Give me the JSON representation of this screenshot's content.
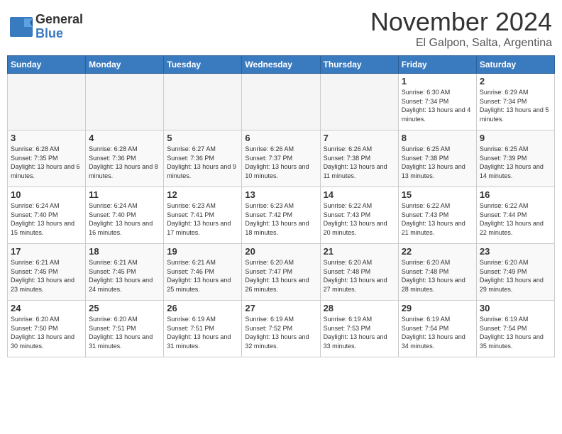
{
  "header": {
    "logo_general": "General",
    "logo_blue": "Blue",
    "month": "November 2024",
    "location": "El Galpon, Salta, Argentina"
  },
  "weekdays": [
    "Sunday",
    "Monday",
    "Tuesday",
    "Wednesday",
    "Thursday",
    "Friday",
    "Saturday"
  ],
  "weeks": [
    [
      {
        "day": "",
        "info": ""
      },
      {
        "day": "",
        "info": ""
      },
      {
        "day": "",
        "info": ""
      },
      {
        "day": "",
        "info": ""
      },
      {
        "day": "",
        "info": ""
      },
      {
        "day": "1",
        "info": "Sunrise: 6:30 AM\nSunset: 7:34 PM\nDaylight: 13 hours and 4 minutes."
      },
      {
        "day": "2",
        "info": "Sunrise: 6:29 AM\nSunset: 7:34 PM\nDaylight: 13 hours and 5 minutes."
      }
    ],
    [
      {
        "day": "3",
        "info": "Sunrise: 6:28 AM\nSunset: 7:35 PM\nDaylight: 13 hours and 6 minutes."
      },
      {
        "day": "4",
        "info": "Sunrise: 6:28 AM\nSunset: 7:36 PM\nDaylight: 13 hours and 8 minutes."
      },
      {
        "day": "5",
        "info": "Sunrise: 6:27 AM\nSunset: 7:36 PM\nDaylight: 13 hours and 9 minutes."
      },
      {
        "day": "6",
        "info": "Sunrise: 6:26 AM\nSunset: 7:37 PM\nDaylight: 13 hours and 10 minutes."
      },
      {
        "day": "7",
        "info": "Sunrise: 6:26 AM\nSunset: 7:38 PM\nDaylight: 13 hours and 11 minutes."
      },
      {
        "day": "8",
        "info": "Sunrise: 6:25 AM\nSunset: 7:38 PM\nDaylight: 13 hours and 13 minutes."
      },
      {
        "day": "9",
        "info": "Sunrise: 6:25 AM\nSunset: 7:39 PM\nDaylight: 13 hours and 14 minutes."
      }
    ],
    [
      {
        "day": "10",
        "info": "Sunrise: 6:24 AM\nSunset: 7:40 PM\nDaylight: 13 hours and 15 minutes."
      },
      {
        "day": "11",
        "info": "Sunrise: 6:24 AM\nSunset: 7:40 PM\nDaylight: 13 hours and 16 minutes."
      },
      {
        "day": "12",
        "info": "Sunrise: 6:23 AM\nSunset: 7:41 PM\nDaylight: 13 hours and 17 minutes."
      },
      {
        "day": "13",
        "info": "Sunrise: 6:23 AM\nSunset: 7:42 PM\nDaylight: 13 hours and 18 minutes."
      },
      {
        "day": "14",
        "info": "Sunrise: 6:22 AM\nSunset: 7:43 PM\nDaylight: 13 hours and 20 minutes."
      },
      {
        "day": "15",
        "info": "Sunrise: 6:22 AM\nSunset: 7:43 PM\nDaylight: 13 hours and 21 minutes."
      },
      {
        "day": "16",
        "info": "Sunrise: 6:22 AM\nSunset: 7:44 PM\nDaylight: 13 hours and 22 minutes."
      }
    ],
    [
      {
        "day": "17",
        "info": "Sunrise: 6:21 AM\nSunset: 7:45 PM\nDaylight: 13 hours and 23 minutes."
      },
      {
        "day": "18",
        "info": "Sunrise: 6:21 AM\nSunset: 7:45 PM\nDaylight: 13 hours and 24 minutes."
      },
      {
        "day": "19",
        "info": "Sunrise: 6:21 AM\nSunset: 7:46 PM\nDaylight: 13 hours and 25 minutes."
      },
      {
        "day": "20",
        "info": "Sunrise: 6:20 AM\nSunset: 7:47 PM\nDaylight: 13 hours and 26 minutes."
      },
      {
        "day": "21",
        "info": "Sunrise: 6:20 AM\nSunset: 7:48 PM\nDaylight: 13 hours and 27 minutes."
      },
      {
        "day": "22",
        "info": "Sunrise: 6:20 AM\nSunset: 7:48 PM\nDaylight: 13 hours and 28 minutes."
      },
      {
        "day": "23",
        "info": "Sunrise: 6:20 AM\nSunset: 7:49 PM\nDaylight: 13 hours and 29 minutes."
      }
    ],
    [
      {
        "day": "24",
        "info": "Sunrise: 6:20 AM\nSunset: 7:50 PM\nDaylight: 13 hours and 30 minutes."
      },
      {
        "day": "25",
        "info": "Sunrise: 6:20 AM\nSunset: 7:51 PM\nDaylight: 13 hours and 31 minutes."
      },
      {
        "day": "26",
        "info": "Sunrise: 6:19 AM\nSunset: 7:51 PM\nDaylight: 13 hours and 31 minutes."
      },
      {
        "day": "27",
        "info": "Sunrise: 6:19 AM\nSunset: 7:52 PM\nDaylight: 13 hours and 32 minutes."
      },
      {
        "day": "28",
        "info": "Sunrise: 6:19 AM\nSunset: 7:53 PM\nDaylight: 13 hours and 33 minutes."
      },
      {
        "day": "29",
        "info": "Sunrise: 6:19 AM\nSunset: 7:54 PM\nDaylight: 13 hours and 34 minutes."
      },
      {
        "day": "30",
        "info": "Sunrise: 6:19 AM\nSunset: 7:54 PM\nDaylight: 13 hours and 35 minutes."
      }
    ]
  ]
}
